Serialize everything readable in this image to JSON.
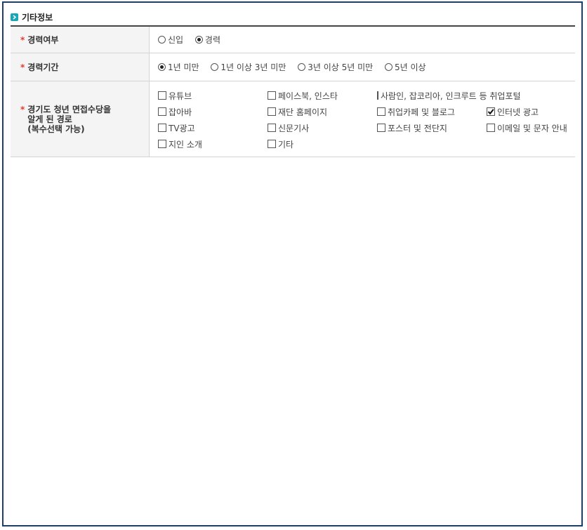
{
  "section": {
    "title": "기타정보",
    "icon": "chevron-right-icon",
    "accent": "#19a7b7"
  },
  "rows": {
    "experience": {
      "label": "경력여부",
      "options": [
        {
          "label": "신입",
          "checked": false
        },
        {
          "label": "경력",
          "checked": true
        }
      ]
    },
    "duration": {
      "label": "경력기간",
      "options": [
        {
          "label": "1년 미만",
          "checked": true
        },
        {
          "label": "1년 이상 3년 미만",
          "checked": false
        },
        {
          "label": "3년 이상 5년 미만",
          "checked": false
        },
        {
          "label": "5년 이상",
          "checked": false
        }
      ]
    },
    "source": {
      "label_lines": [
        "경기도 청년 면접수당을",
        "알게 된 경로",
        "(복수선택 가능)"
      ],
      "options": [
        {
          "label": "유튜브",
          "checked": false
        },
        {
          "label": "페이스북, 인스타",
          "checked": false
        },
        {
          "label": "사람인, 잡코리아, 인크루트 등 취업포털",
          "checked": false
        },
        {
          "label": "잡아바",
          "checked": false
        },
        {
          "label": "재단 홈페이지",
          "checked": false
        },
        {
          "label": "취업카페 및 블로그",
          "checked": false
        },
        {
          "label": "인터넷 광고",
          "checked": true
        },
        {
          "label": "TV광고",
          "checked": false
        },
        {
          "label": "신문기사",
          "checked": false
        },
        {
          "label": "포스터 및 전단지",
          "checked": false
        },
        {
          "label": "이메일 및 문자 안내",
          "checked": false
        },
        {
          "label": "지인 소개",
          "checked": false
        },
        {
          "label": "기타",
          "checked": false
        }
      ]
    }
  },
  "required_mark": "*"
}
